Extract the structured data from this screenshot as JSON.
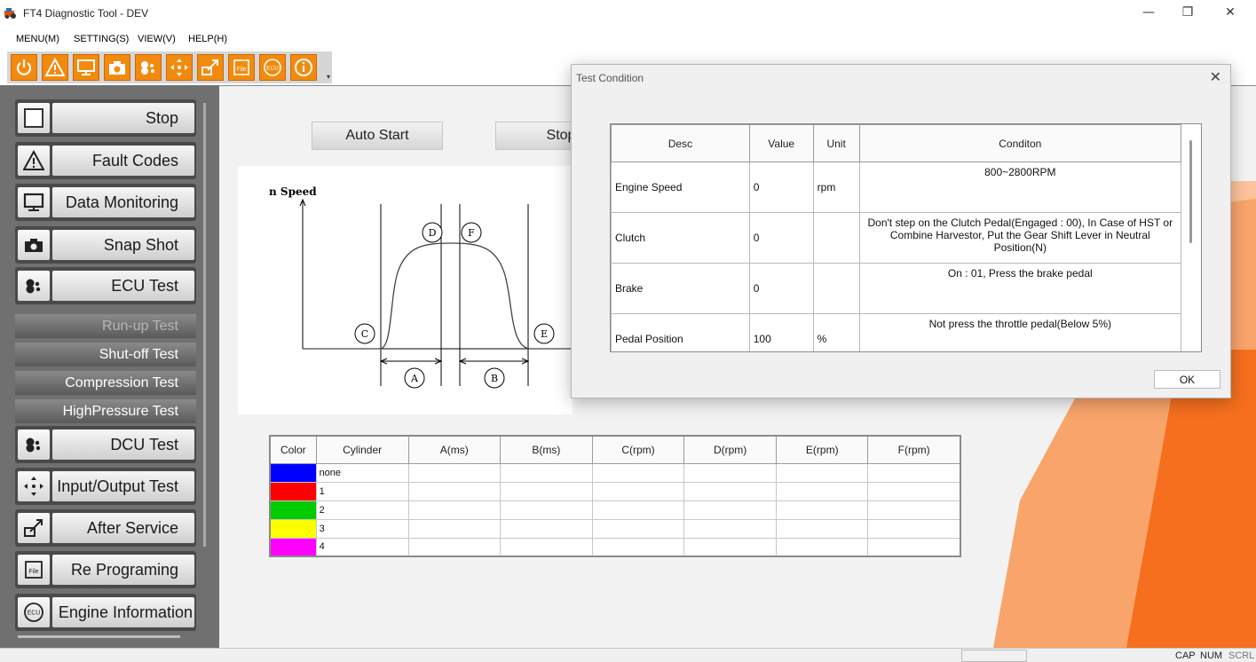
{
  "window": {
    "title": "FT4 Diagnostic Tool - DEV",
    "minimize": "—",
    "maximize": "❐",
    "close": "✕"
  },
  "menu": [
    "MENU(M)",
    "SETTING(S)",
    "VIEW(V)",
    "HELP(H)"
  ],
  "toolbar": {
    "icons": [
      "power-icon",
      "warning-icon",
      "monitor-icon",
      "camera-icon",
      "ecu-test-icon",
      "input-output-icon",
      "after-service-icon",
      "file-icon",
      "ecu-icon",
      "info-icon"
    ],
    "file_text": "File",
    "ecu_text": "ECU",
    "accent": "#f28a0e"
  },
  "sidebar": {
    "items": [
      {
        "label": "Stop",
        "icon": "stop-icon"
      },
      {
        "label": "Fault Codes",
        "icon": "warning-icon"
      },
      {
        "label": "Data Monitoring",
        "icon": "monitor-icon"
      },
      {
        "label": "Snap Shot",
        "icon": "camera-icon"
      },
      {
        "label": "ECU Test",
        "icon": "ecu-test-icon"
      },
      {
        "label": "Run-up Test",
        "sub": true,
        "disabled": true
      },
      {
        "label": "Shut-off Test",
        "sub": true
      },
      {
        "label": "Compression Test",
        "sub": true
      },
      {
        "label": "HighPressure Test",
        "sub": true
      },
      {
        "label": "DCU Test",
        "icon": "dcu-test-icon"
      },
      {
        "label": "Input/Output Test",
        "icon": "input-output-icon"
      },
      {
        "label": "After Service",
        "icon": "after-service-icon"
      },
      {
        "label": "Re Programing",
        "icon": "file-icon"
      },
      {
        "label": "Engine Information",
        "icon": "ecu-icon"
      }
    ]
  },
  "main": {
    "auto_start": "Auto Start",
    "stop": "Stop",
    "graph": {
      "ylabel": "n Speed",
      "points": [
        "A",
        "B",
        "C",
        "D",
        "E",
        "F"
      ]
    },
    "results": {
      "headers": [
        "Color",
        "Cylinder",
        "A(ms)",
        "B(ms)",
        "C(rpm)",
        "D(rpm)",
        "E(rpm)",
        "F(rpm)"
      ],
      "rows": [
        {
          "color": "#0000ff",
          "cylinder": "none"
        },
        {
          "color": "#ff0000",
          "cylinder": "1"
        },
        {
          "color": "#00cc00",
          "cylinder": "2"
        },
        {
          "color": "#ffff00",
          "cylinder": "3"
        },
        {
          "color": "#ff00ff",
          "cylinder": "4"
        }
      ]
    }
  },
  "dialog": {
    "title": "Test Condition",
    "close": "✕",
    "headers": [
      "Desc",
      "Value",
      "Unit",
      "Conditon"
    ],
    "rows": [
      {
        "desc": "Engine Speed",
        "value": "0",
        "unit": "rpm",
        "condition": "800~2800RPM"
      },
      {
        "desc": "Clutch",
        "value": "0",
        "unit": "",
        "condition": "Don't step on the Clutch Pedal(Engaged : 00), In Case of HST or Combine Harvestor, Put the Gear Shift Lever in Neutral Position(N)"
      },
      {
        "desc": "Brake",
        "value": "0",
        "unit": "",
        "condition": "On : 01, Press the brake pedal"
      },
      {
        "desc": "Pedal Position",
        "value": "100",
        "unit": "%",
        "condition": "Not press the throttle pedal(Below 5%)"
      }
    ],
    "ok": "OK"
  },
  "status": {
    "cap": "CAP",
    "num": "NUM",
    "scrl": "SCRL"
  }
}
